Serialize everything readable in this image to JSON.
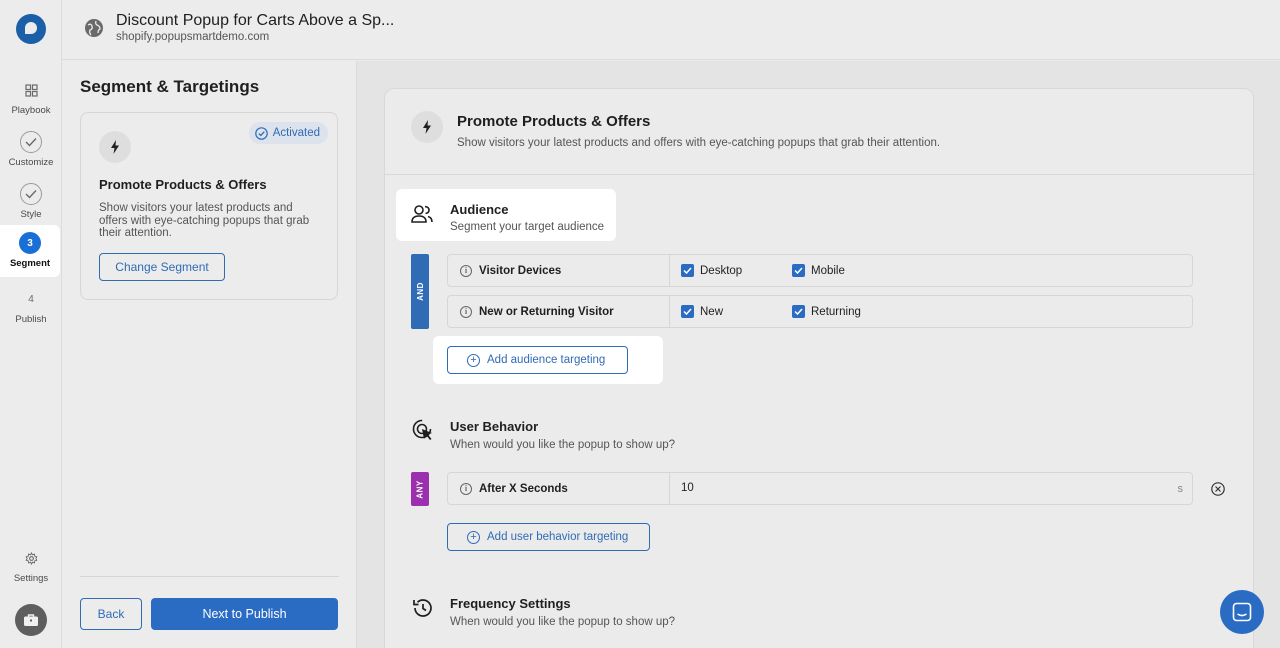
{
  "rail": {
    "items": [
      {
        "label": "Playbook",
        "icon": "grid-icon",
        "num": ""
      },
      {
        "label": "Customize",
        "icon": "check-circle-icon",
        "num": ""
      },
      {
        "label": "Style",
        "icon": "check-circle-icon",
        "num": ""
      },
      {
        "label": "Segment",
        "icon": "step-number",
        "num": "3"
      },
      {
        "label": "Publish",
        "icon": "step-number",
        "num": "4"
      }
    ],
    "settings_label": "Settings"
  },
  "header": {
    "title": "Discount Popup for Carts Above a Sp...",
    "url": "shopify.popupsmartdemo.com"
  },
  "left": {
    "heading": "Segment & Targetings",
    "segment_card": {
      "badge": "Activated",
      "title": "Promote Products & Offers",
      "description": "Show visitors your latest products and offers with eye-catching popups that grab their attention.",
      "change_label": "Change Segment"
    },
    "back_label": "Back",
    "next_label": "Next to Publish"
  },
  "main": {
    "card_title": "Promote Products & Offers",
    "card_desc": "Show visitors your latest products and offers with eye-catching popups that grab their attention.",
    "audience": {
      "title": "Audience",
      "desc": "Segment your target audience",
      "logic": "AND",
      "rules": [
        {
          "name": "Visitor Devices",
          "options": [
            {
              "label": "Desktop",
              "checked": true
            },
            {
              "label": "Mobile",
              "checked": true
            }
          ]
        },
        {
          "name": "New or Returning Visitor",
          "options": [
            {
              "label": "New",
              "checked": true
            },
            {
              "label": "Returning",
              "checked": true
            }
          ]
        }
      ],
      "add_label": "Add audience targeting"
    },
    "behavior": {
      "title": "User Behavior",
      "desc": "When would you like the popup to show up?",
      "logic": "ANY",
      "rule_name": "After X Seconds",
      "rule_value": "10",
      "rule_unit": "s",
      "add_label": "Add user behavior targeting"
    },
    "frequency": {
      "title": "Frequency Settings",
      "desc": "When would you like the popup to show up?"
    }
  },
  "colors": {
    "primary": "#2a6bc4",
    "and_tag": "#2f6cb5",
    "any_tag": "#9b2fae"
  }
}
